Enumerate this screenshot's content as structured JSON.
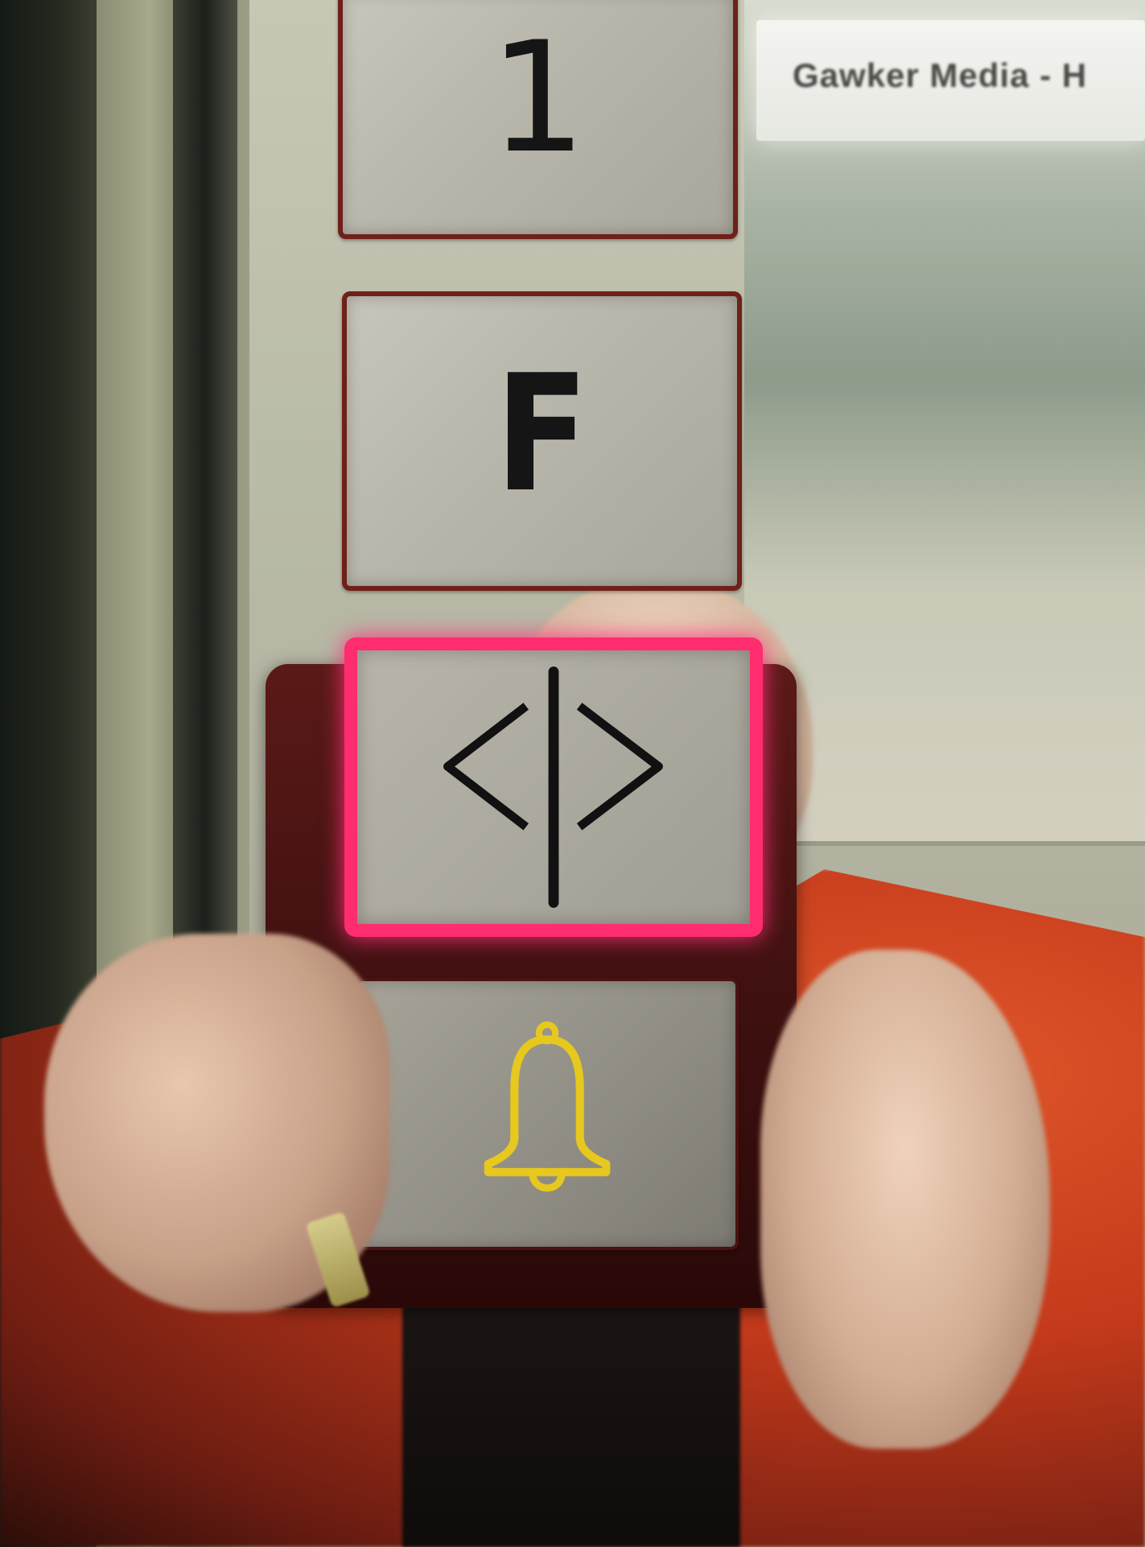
{
  "sign": {
    "text": "Gawker Media - H"
  },
  "buttons": {
    "floor_1": {
      "label": "1"
    },
    "floor_f": {
      "label": "F"
    },
    "door": {
      "icon": "door-open-icon",
      "lit": true,
      "light_color": "#ff2d6f"
    },
    "alarm": {
      "icon": "alarm-bell-icon",
      "color": "#e6c81e"
    }
  },
  "colors": {
    "button_border": "#6e2019",
    "jacket": "#c43a1b"
  }
}
